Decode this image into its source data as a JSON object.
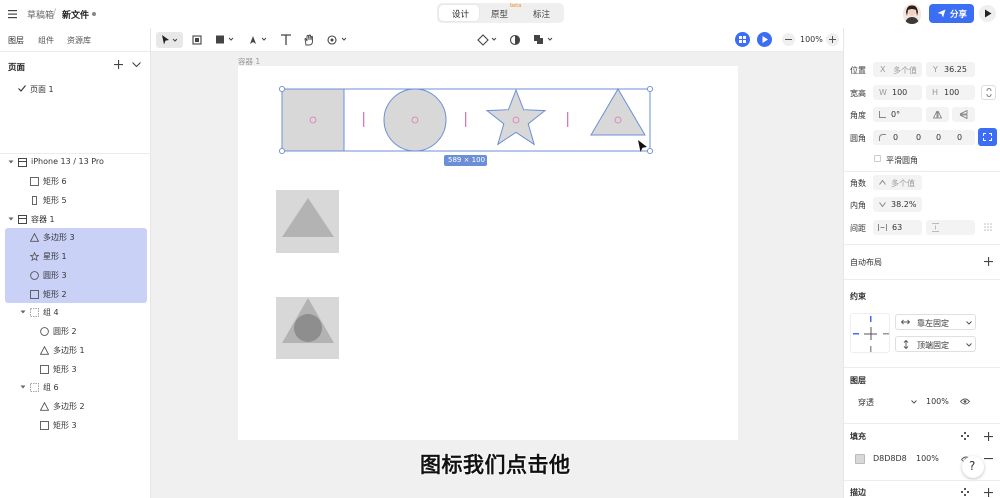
{
  "topbar": {
    "breadcrumb_parent": "草稿箱",
    "breadcrumb_sep": "/",
    "file_name": "新文件",
    "modes": [
      "设计",
      "原型",
      "标注"
    ],
    "beta_badge": "beta",
    "share_label": "分享"
  },
  "subbar": {
    "tabs": [
      "图层",
      "组件",
      "资源库"
    ],
    "zoom": "100%"
  },
  "layers": {
    "pages_title": "页面",
    "page_item": "页面 1",
    "tree": [
      {
        "label": "iPhone 13 / 13 Pro",
        "indent": 0,
        "icon": "frame",
        "caret": true,
        "selected": false
      },
      {
        "label": "矩形 6",
        "indent": 1,
        "icon": "rect",
        "caret": false,
        "selected": false
      },
      {
        "label": "矩形 5",
        "indent": 1,
        "icon": "rect-tall",
        "caret": false,
        "selected": false
      },
      {
        "label": "容器 1",
        "indent": 0,
        "icon": "frame",
        "caret": true,
        "selected": false
      },
      {
        "label": "多边形 3",
        "indent": 1,
        "icon": "triangle",
        "caret": false,
        "selected": true
      },
      {
        "label": "星形 1",
        "indent": 1,
        "icon": "star",
        "caret": false,
        "selected": true
      },
      {
        "label": "圆形 3",
        "indent": 1,
        "icon": "circle",
        "caret": false,
        "selected": true
      },
      {
        "label": "矩形 2",
        "indent": 1,
        "icon": "rect",
        "caret": false,
        "selected": true
      },
      {
        "label": "组 4",
        "indent": 1,
        "icon": "group",
        "caret": true,
        "selected": false
      },
      {
        "label": "圆形 2",
        "indent": 2,
        "icon": "circle",
        "caret": false,
        "selected": false
      },
      {
        "label": "多边形 1",
        "indent": 2,
        "icon": "triangle",
        "caret": false,
        "selected": false
      },
      {
        "label": "矩形 3",
        "indent": 2,
        "icon": "rect",
        "caret": false,
        "selected": false
      },
      {
        "label": "组 6",
        "indent": 1,
        "icon": "group",
        "caret": true,
        "selected": false
      },
      {
        "label": "多边形 2",
        "indent": 2,
        "icon": "triangle",
        "caret": false,
        "selected": false
      },
      {
        "label": "矩形 3",
        "indent": 2,
        "icon": "rect",
        "caret": false,
        "selected": false
      }
    ]
  },
  "canvas": {
    "frame_label": "容器 1",
    "selection_size": "589 × 100",
    "subtitle": "图标我们点击他"
  },
  "props": {
    "position_label": "位置",
    "x_key": "X",
    "x_value": "多个值",
    "y_key": "Y",
    "y_value": "36.25",
    "size_label": "宽高",
    "w_key": "W",
    "w_value": "100",
    "h_key": "H",
    "h_value": "100",
    "angle_label": "角度",
    "angle_value": "0°",
    "radius_label": "圆角",
    "radius_values": [
      "0",
      "0",
      "0",
      "0"
    ],
    "smooth_label": "平滑圆角",
    "corners_label": "角数",
    "corners_value": "多个值",
    "inner_label": "内角",
    "inner_value": "38.2%",
    "spacing_label": "间距",
    "spacing_value": "63",
    "autolayout_label": "自动布局",
    "constraint_label": "约束",
    "constraint_h": "靠左固定",
    "constraint_v": "顶端固定",
    "layer_label": "图层",
    "blend_mode": "穿透",
    "layer_opacity": "100%",
    "fill_label": "填充",
    "fill_hex": "D8D8D8",
    "fill_opacity": "100%",
    "stroke_label": "描边",
    "help": "?"
  },
  "colors": {
    "accent": "#3b6ef5",
    "selection": "#c9d1f7",
    "shape_fill": "#d8d8d8",
    "shape_stroke": "#6b8fd6"
  }
}
